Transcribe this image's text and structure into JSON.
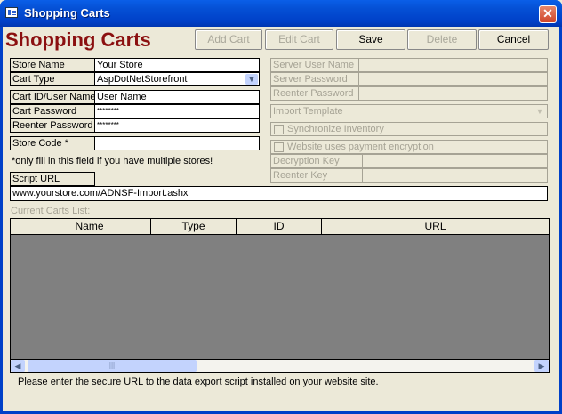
{
  "window": {
    "title": "Shopping Carts"
  },
  "heading": "Shopping Carts",
  "toolbar": {
    "add_cart": "Add Cart",
    "edit_cart": "Edit Cart",
    "save": "Save",
    "delete": "Delete",
    "cancel": "Cancel"
  },
  "form": {
    "store_name_label": "Store Name",
    "store_name_value": "Your Store",
    "cart_type_label": "Cart Type",
    "cart_type_value": "AspDotNetStorefront",
    "cart_id_label": "Cart ID/User Name",
    "cart_id_value": "User Name",
    "cart_password_label": "Cart Password",
    "cart_password_value": "********",
    "reenter_password_label": "Reenter Password",
    "reenter_password_value": "********",
    "store_code_label": "Store Code  *",
    "store_code_value": "",
    "store_code_note": "*only fill in this field if you have multiple stores!",
    "script_url_label": "Script URL",
    "script_url_value": "www.yourstore.com/ADNSF-Import.ashx"
  },
  "server": {
    "server_user_label": "Server User Name",
    "server_password_label": "Server Password",
    "reenter_password_label": "Reenter Password",
    "import_template_label": "Import Template",
    "sync_inventory_label": "Synchronize Inventory",
    "encryption_label": "Website uses payment encryption",
    "decryption_key_label": "Decryption Key",
    "reenter_key_label": "Reenter Key"
  },
  "carts_list": {
    "label": "Current Carts List:",
    "columns": [
      "Name",
      "Type",
      "ID",
      "URL"
    ]
  },
  "status": {
    "text": "Please enter the secure URL to the data export script installed on your website site."
  },
  "icons": {
    "close": "close-icon",
    "app": "form-icon",
    "dropdown": "chevron-down-icon",
    "scroll_left": "arrow-left-icon",
    "scroll_right": "arrow-right-icon"
  }
}
